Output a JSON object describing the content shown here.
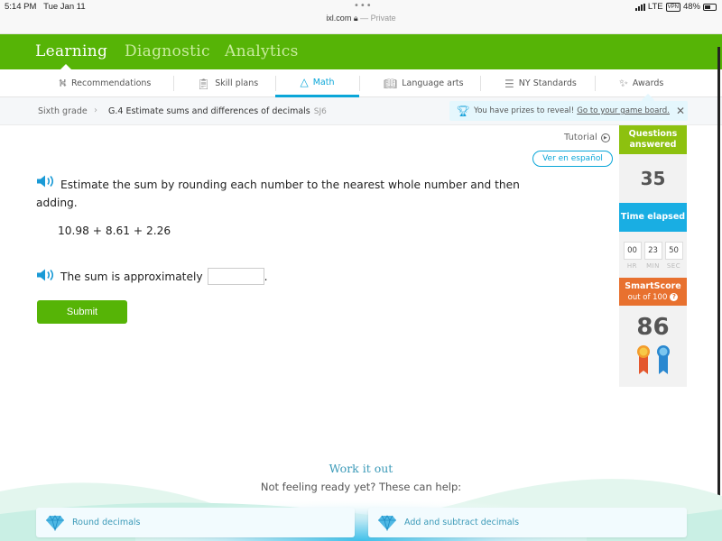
{
  "status_bar": {
    "time": "5:14 PM",
    "date": "Tue Jan 11",
    "url": "ixl.com",
    "private_label": "— Private",
    "network": "LTE",
    "vpn": "VPN",
    "battery": "48%"
  },
  "top_nav": {
    "items": [
      {
        "label": "Learning",
        "active": true
      },
      {
        "label": "Diagnostic",
        "active": false
      },
      {
        "label": "Analytics",
        "active": false
      }
    ]
  },
  "sub_nav": {
    "tabs": [
      {
        "label": "Recommendations",
        "icon": "signpost-icon"
      },
      {
        "label": "Skill plans",
        "icon": "clipboard-icon"
      },
      {
        "label": "Math",
        "icon": "pyramid-icon",
        "active": true
      },
      {
        "label": "Language arts",
        "icon": "book-icon"
      },
      {
        "label": "NY Standards",
        "icon": "checklist-icon"
      },
      {
        "label": "Awards",
        "icon": "confetti-icon"
      }
    ]
  },
  "breadcrumb": {
    "grade": "Sixth grade",
    "skill": "G.4 Estimate sums and differences of decimals",
    "code": "SJ6"
  },
  "prize_banner": {
    "text": "You have prizes to reveal!",
    "link": "Go to your game board."
  },
  "links": {
    "tutorial": "Tutorial",
    "spanish": "Ver en español"
  },
  "question": {
    "prompt": "Estimate the sum by rounding each number to the nearest whole number and then adding.",
    "expression": "10.98 + 8.61 + 2.26",
    "answer_prefix": "The sum is approximately",
    "answer_suffix": ".",
    "answer_value": "",
    "submit_label": "Submit"
  },
  "sidebar": {
    "questions_label": "Questions answered",
    "questions_count": "35",
    "time_label": "Time elapsed",
    "time": {
      "hr": "00",
      "min": "23",
      "sec": "50"
    },
    "time_units": {
      "hr": "HR",
      "min": "MIN",
      "sec": "SEC"
    },
    "smartscore_label": "SmartScore",
    "smartscore_sub": "out of 100",
    "smartscore_value": "86"
  },
  "footer": {
    "title": "Work it out",
    "subtitle": "Not feeling ready yet? These can help:",
    "cards": [
      {
        "label": "Round decimals",
        "icon": "diamond-icon"
      },
      {
        "label": "Add and subtract decimals",
        "icon": "diamond-icon"
      }
    ]
  },
  "colors": {
    "brand_green": "#56b406",
    "accent_blue": "#0aa6d8",
    "questions_green": "#8dc10f",
    "time_blue": "#19aee3",
    "smartscore_orange": "#e8712f"
  }
}
